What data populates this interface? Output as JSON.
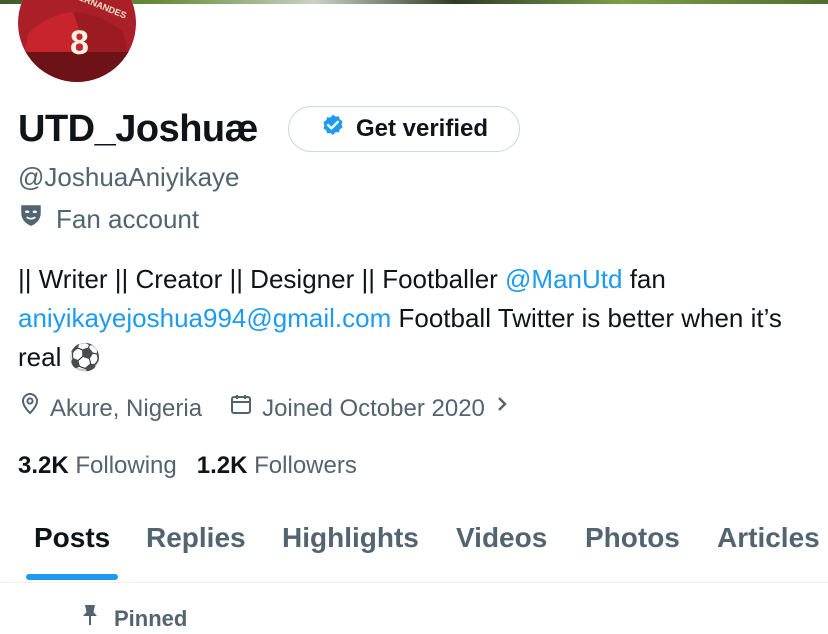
{
  "profile": {
    "display_name": "UTD_Joshuæ",
    "verify_button_label": "Get verified",
    "handle": "@JoshuaAniyikaye",
    "category_label": "Fan account",
    "avatar_jersey_name": "B.FERNANDES",
    "avatar_jersey_number": "8"
  },
  "bio": {
    "part1": "|| Writer || Creator || Designer || Footballer ",
    "mention": "@ManUtd",
    "part2": " fan ",
    "email": "aniyikayejoshua994@gmail.com",
    "part3": " Football Twitter is better when it’s real ",
    "emoji": "⚽"
  },
  "meta": {
    "location": "Akure, Nigeria",
    "joined": "Joined October 2020"
  },
  "stats": {
    "following_count": "3.2K",
    "following_label": "Following",
    "followers_count": "1.2K",
    "followers_label": "Followers"
  },
  "tabs": [
    {
      "label": "Posts",
      "active": true
    },
    {
      "label": "Replies",
      "active": false
    },
    {
      "label": "Highlights",
      "active": false
    },
    {
      "label": "Videos",
      "active": false
    },
    {
      "label": "Photos",
      "active": false
    },
    {
      "label": "Articles",
      "active": false
    }
  ],
  "pinned_label": "Pinned",
  "colors": {
    "accent": "#1d9bf0",
    "text_primary": "#0f1419",
    "text_secondary": "#536471",
    "verified_badge": "#1d9bf0"
  },
  "icons": {
    "category": "theater-masks-icon",
    "location": "location-pin-icon",
    "calendar": "calendar-icon",
    "chevron": "chevron-right-icon",
    "verified": "verified-badge-icon",
    "pin": "pin-icon"
  }
}
